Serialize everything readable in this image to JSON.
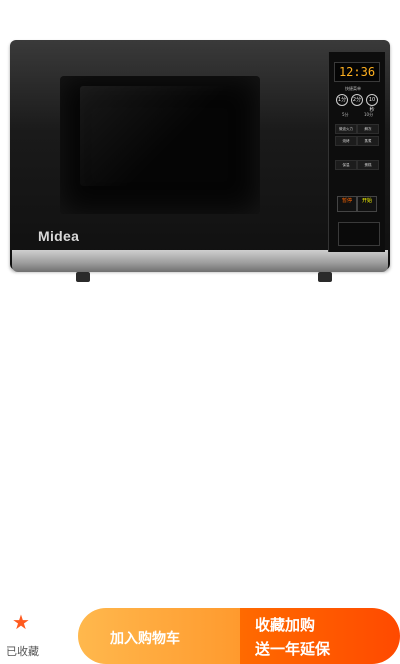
{
  "product": {
    "brand": "Midea",
    "display_time": "12:36",
    "panel": {
      "title": "快捷菜单",
      "knobs": [
        "1分",
        "2分",
        "10秒"
      ],
      "knob_sub": [
        "5分",
        "10分"
      ],
      "buttons": [
        "微波火力",
        "解冻",
        "烧烤",
        "蒸煮",
        "保温",
        "蛋糕"
      ],
      "pause_label": "暂停",
      "start_label": "开始"
    }
  },
  "bottom_bar": {
    "favorite_icon": "star-icon",
    "favorite_label": "已收藏",
    "add_to_cart_label": "加入购物车",
    "collect_line1": "收藏加购",
    "collect_line2": "送一年延保",
    "accent_orange": "#ff6a00",
    "light_orange": "#ffb84d"
  }
}
